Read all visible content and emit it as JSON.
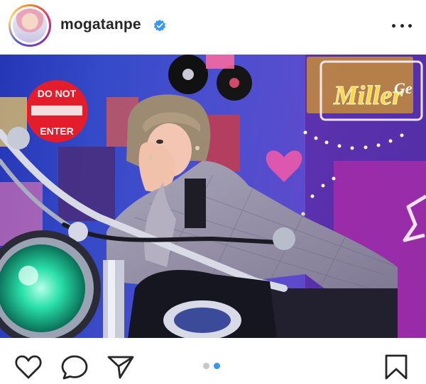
{
  "post": {
    "username": "mogatanpe",
    "verified": true,
    "photo": {
      "sign_text_line1": "DO NOT",
      "sign_text_line2": "ENTER",
      "neon_text": "Miller",
      "neon_text_2": "Ge"
    },
    "carousel": {
      "count": 2,
      "active_index": 1
    },
    "icons": {
      "like": "heart-icon",
      "comment": "comment-icon",
      "share": "send-icon",
      "save": "bookmark-icon",
      "more": "more-options-icon",
      "verified": "verified-badge-icon"
    },
    "colors": {
      "accent_blue": "#3897f0",
      "dot_inactive": "#c7c7c7",
      "text": "#262626"
    }
  }
}
